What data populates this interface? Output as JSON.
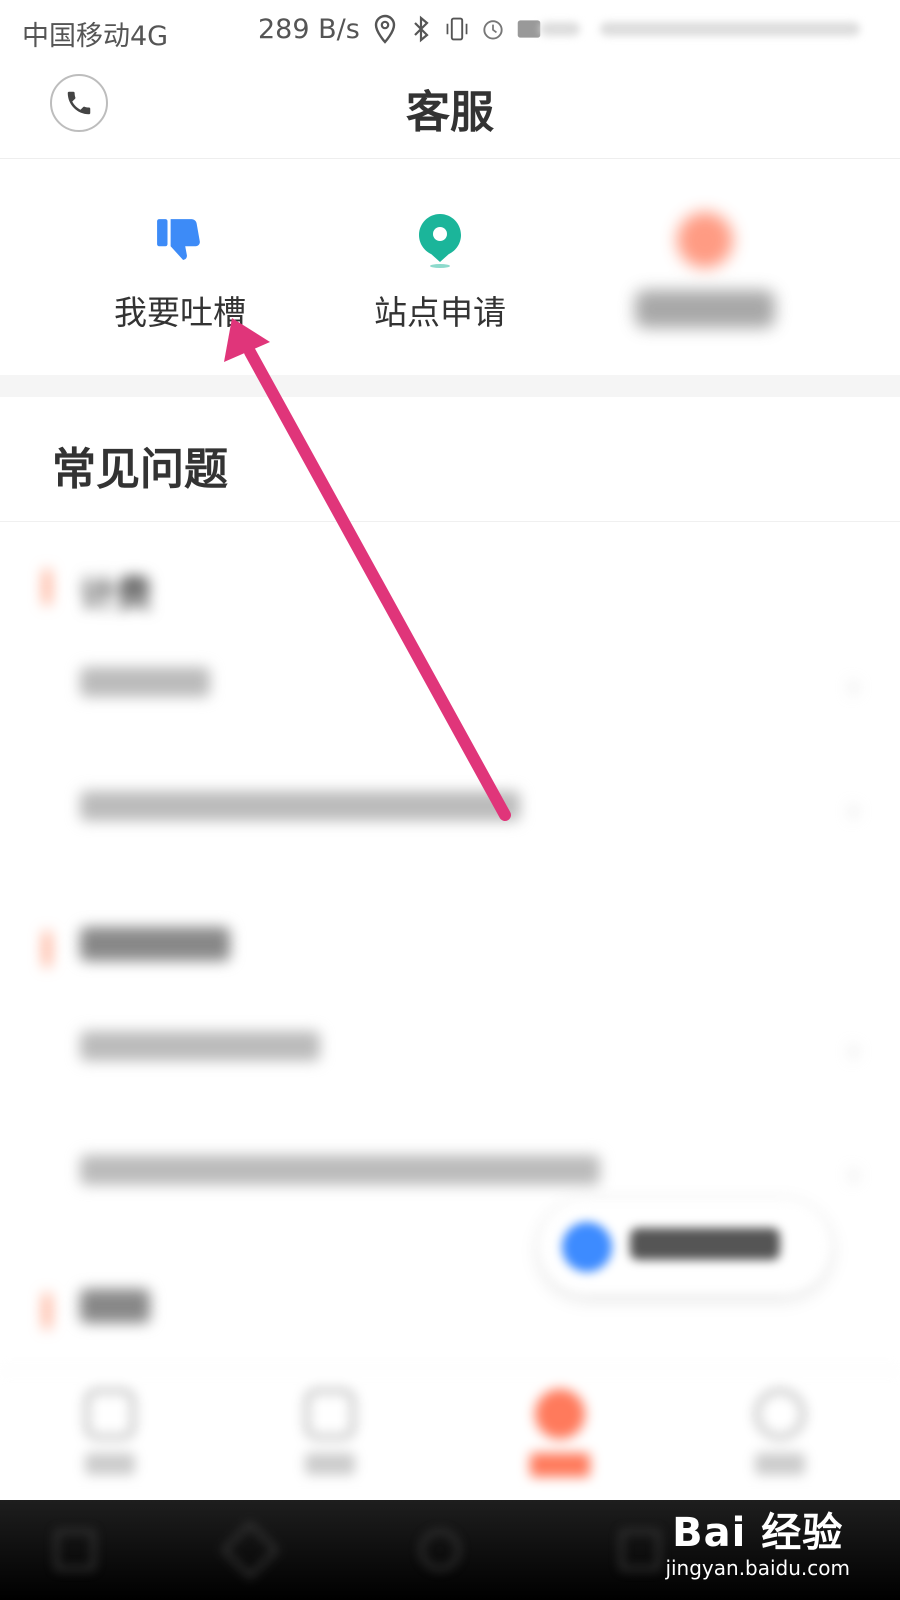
{
  "status_bar": {
    "carrier": "中国移动4G",
    "speed": "289 B/s"
  },
  "header": {
    "title": "客服"
  },
  "shortcuts": [
    {
      "label": "我要吐槽",
      "icon": "thumbs-down-icon",
      "color": "#3d8bf7"
    },
    {
      "label": "站点申请",
      "icon": "location-pin-icon",
      "color": "#1bb59a"
    },
    {
      "label": "",
      "icon": "blurred-icon",
      "color": "#ff8a6e"
    }
  ],
  "faq": {
    "title": "常见问题",
    "categories": [
      {
        "name": "计费"
      },
      {
        "name": ""
      },
      {
        "name": ""
      }
    ]
  },
  "annotation": {
    "arrow_color": "#e0357a"
  },
  "watermark": {
    "logo": "Bai 经验",
    "url": "jingyan.baidu.com"
  }
}
